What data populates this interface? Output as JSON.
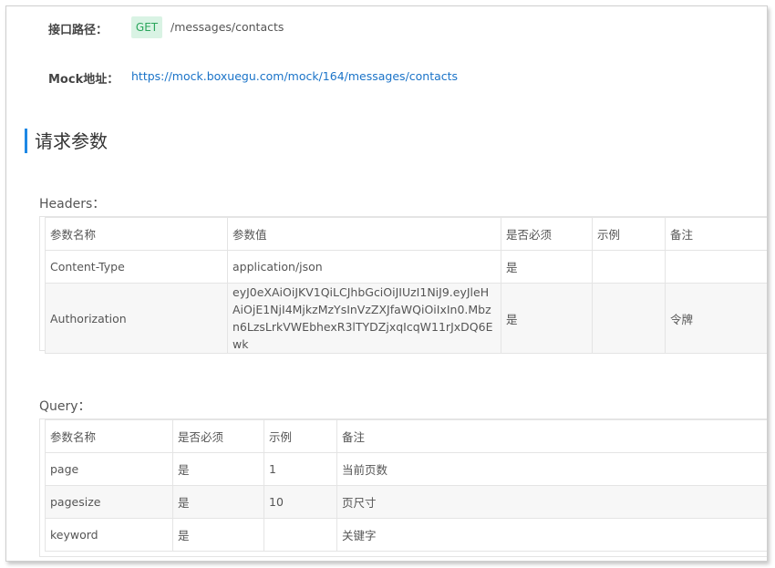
{
  "api": {
    "path_label": "接口路径：",
    "method": "GET",
    "path": "/messages/contacts",
    "mock_label": "Mock地址：",
    "mock_url": "https://mock.boxuegu.com/mock/164/messages/contacts"
  },
  "section_title": "请求参数",
  "headers": {
    "title": "Headers：",
    "columns": [
      "参数名称",
      "参数值",
      "是否必须",
      "示例",
      "备注"
    ],
    "rows": [
      {
        "name": "Content-Type",
        "value": "application/json",
        "required": "是",
        "example": "",
        "note": ""
      },
      {
        "name": "Authorization",
        "value": "eyJ0eXAiOiJKV1QiLCJhbGciOiJIUzI1NiJ9.eyJleHAiOjE1NjI4MjkzMzYsInVzZXJfaWQiOiIxIn0.Mbzn6LzsLrkVWEbhexR3lTYDZjxqIcqW11rJxDQ6Ewk",
        "required": "是",
        "example": "",
        "note": "令牌"
      }
    ]
  },
  "query": {
    "title": "Query：",
    "columns": [
      "参数名称",
      "是否必须",
      "示例",
      "备注"
    ],
    "rows": [
      {
        "name": "page",
        "required": "是",
        "example": "1",
        "note": "当前页数"
      },
      {
        "name": "pagesize",
        "required": "是",
        "example": "10",
        "note": "页尺寸"
      },
      {
        "name": "keyword",
        "required": "是",
        "example": "",
        "note": "关键字"
      }
    ]
  },
  "colors": {
    "accent": "#1e88e5",
    "get_badge_bg": "#d9f3e4",
    "get_badge_text": "#2aa55b",
    "link": "#1a73c8"
  }
}
